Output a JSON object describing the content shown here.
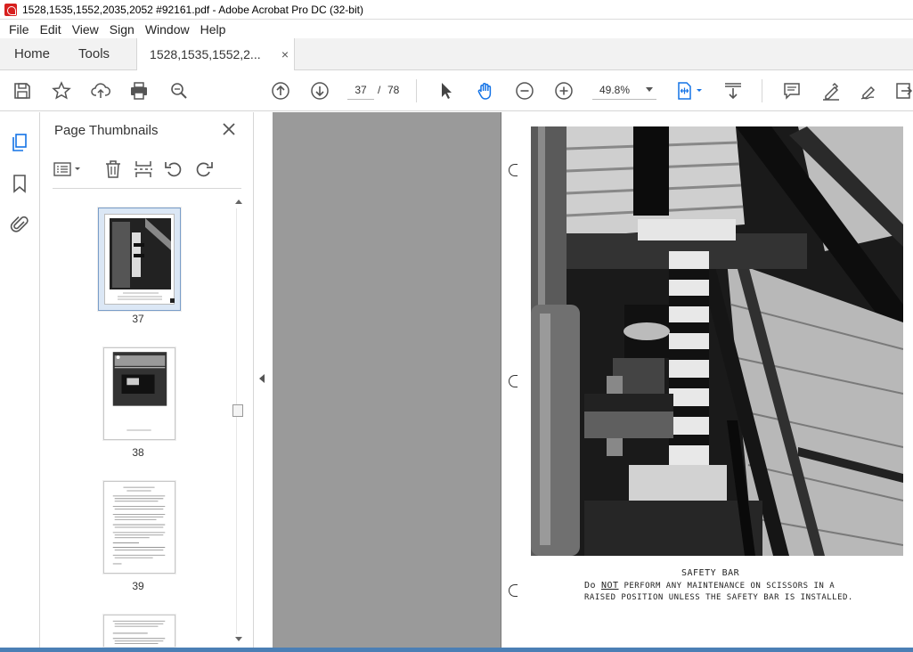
{
  "window": {
    "title": "1528,1535,1552,2035,2052 #92161.pdf - Adobe Acrobat Pro DC (32-bit)"
  },
  "menu": {
    "items": [
      "File",
      "Edit",
      "View",
      "Sign",
      "Window",
      "Help"
    ]
  },
  "tabs": {
    "home": "Home",
    "tools": "Tools",
    "document": "1528,1535,1552,2...",
    "close": "×"
  },
  "toolbar": {
    "icons": [
      "save-icon",
      "bookmark-star-icon",
      "upload-icon",
      "print-icon",
      "zoom-search-icon",
      "page-up-icon",
      "page-down-icon",
      "select-cursor-icon",
      "hand-icon",
      "zoom-out-icon",
      "zoom-in-icon",
      "fit-page-icon",
      "scroll-mode-icon",
      "comment-icon",
      "highlight-icon",
      "sign-icon",
      "export-icon"
    ],
    "page_current": "37",
    "page_separator": "/",
    "page_total": "78",
    "zoom": "49.8%"
  },
  "thumbnails": {
    "title": "Page Thumbnails",
    "pages": [
      {
        "number": "37",
        "selected": true
      },
      {
        "number": "38",
        "selected": false
      },
      {
        "number": "39",
        "selected": false
      }
    ]
  },
  "document": {
    "caption_title": "SAFETY BAR",
    "caption_line1_prefix": "Do",
    "caption_line1_emph": "NOT",
    "caption_line1_rest": "PERFORM ANY MAINTENANCE ON SCISSORS IN A",
    "caption_line2": "RAISED POSITION UNLESS THE SAFETY BAR IS INSTALLED."
  },
  "colors": {
    "accent": "#1473e6",
    "doc_background": "#9a9a9a",
    "app_red": "#d7201f"
  }
}
